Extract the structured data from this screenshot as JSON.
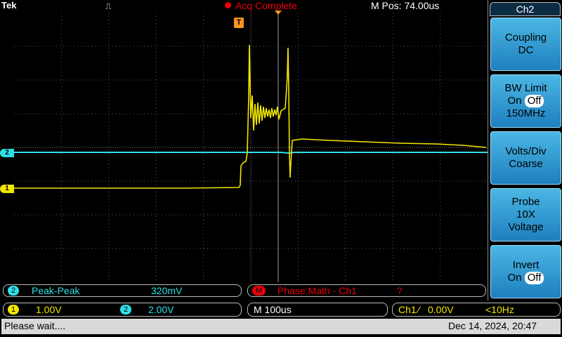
{
  "header": {
    "brand": "Tek",
    "run_icon": "run-icon",
    "acquisition_status": "Acq Complete",
    "m_pos": "M Pos: 74.00us",
    "trigger_marker_label": "T"
  },
  "channels": {
    "ch1_marker": "1",
    "ch2_marker": "2"
  },
  "side_menu": {
    "title": "Ch2",
    "coupling": {
      "label": "Coupling",
      "value": "DC"
    },
    "bw_limit": {
      "label": "BW Limit",
      "on": "On",
      "off": "Off",
      "value": "150MHz"
    },
    "volts_div": {
      "label": "Volts/Div",
      "value": "Coarse"
    },
    "probe": {
      "label": "Probe",
      "atten": "10X",
      "value": "Voltage"
    },
    "invert": {
      "label": "Invert",
      "on": "On",
      "off": "Off"
    }
  },
  "measurements": {
    "m1_channel": "2",
    "m1_label": "Peak-Peak",
    "m1_value": "320mV",
    "m2_badge": "M",
    "m2_label": "Phase:Math - Ch1",
    "m2_value": "?"
  },
  "settings": {
    "ch1_badge": "1",
    "ch1_scale": "1.00V",
    "ch2_badge": "2",
    "ch2_scale": "2.00V",
    "timebase": "M 100us",
    "trigger_source": "Ch1",
    "trigger_slope": "⁄",
    "trigger_level": "0.00V",
    "trigger_freq": "<10Hz"
  },
  "status": {
    "message": "Please wait....",
    "datetime": "Dec 14, 2024, 20:47"
  },
  "colors": {
    "ch1": "#f2e600",
    "ch2": "#2ee0e6",
    "math": "#e8000b",
    "trigger": "#f7941d"
  }
}
